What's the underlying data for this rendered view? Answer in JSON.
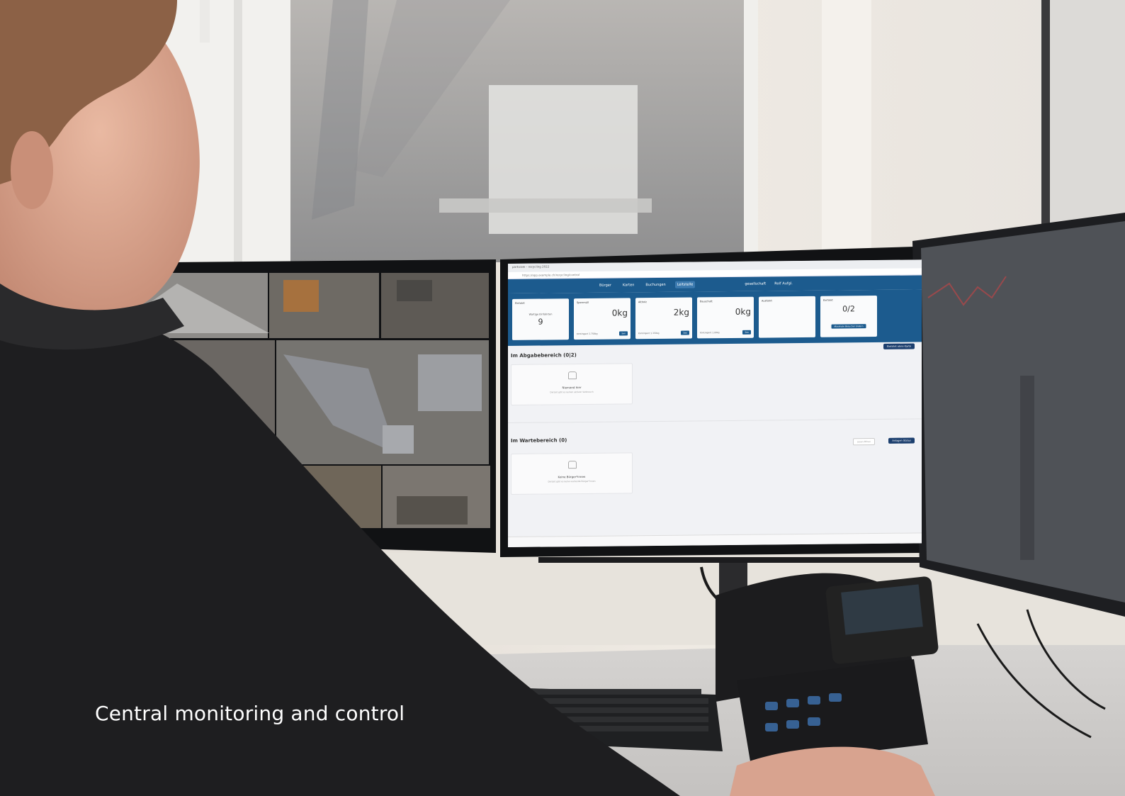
{
  "caption": "Central monitoring and control",
  "screen": {
    "tab_title": "parkview – recycling 2022",
    "address": "https://app.example.ch/recycling/control",
    "nav": {
      "items": [
        "Bürger",
        "Karten",
        "Buchungen",
        "Leitstelle"
      ],
      "active": "Leitstelle",
      "right_items": [
        "gesellschaft",
        "Rolf Aufgl."
      ]
    },
    "cards": [
      {
        "label": "Einfahrt",
        "center_text": "Wartige Einfahrten",
        "center_value": "9"
      },
      {
        "label": "Sperrmüll",
        "value": "0kg",
        "sub": "Kontingent 1.758kg",
        "button": "Sen"
      },
      {
        "label": "Altholz",
        "value": "2kg",
        "sub": "Kontingent 1.159kg",
        "button": "Sen"
      },
      {
        "label": "Bauschutt",
        "value": "0kg",
        "sub": "Kontingent 1.00kg",
        "button": "Sen"
      },
      {
        "label": "Ausfahrt"
      },
      {
        "label": "Einfahrt",
        "value": "0/2",
        "button": "Maximale Besucher ändern"
      }
    ],
    "sections": [
      {
        "title": "Im Abgabebereich (0|2)",
        "button": "Einfahrt ohne Karte",
        "empty_title": "Niemand hier",
        "empty_sub": "Derzeit gibt es keinen aktiven Verbrauch"
      },
      {
        "title": "Im Wartebereich (0)",
        "button": "Anlagen Status",
        "secondary_button": "Lesen öffnen",
        "empty_title": "Keine Bürger*innen",
        "empty_sub": "Derzeit gibt es keine wartende Bürger*innen"
      }
    ],
    "colors": {
      "primary": "#1c5b8e",
      "dark_button": "#1c3f6e"
    }
  }
}
